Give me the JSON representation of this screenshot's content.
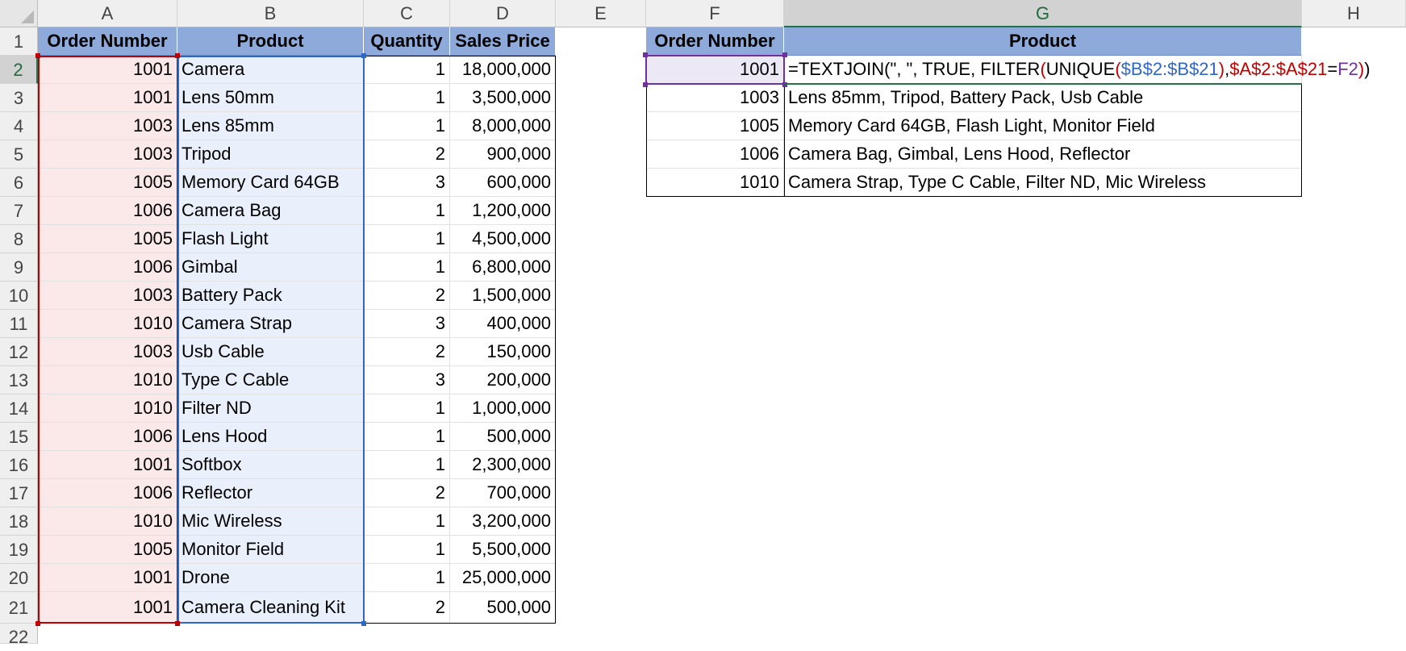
{
  "columns": [
    "A",
    "B",
    "C",
    "D",
    "E",
    "F",
    "G",
    "H"
  ],
  "rows": [
    "1",
    "2",
    "3",
    "4",
    "5",
    "6",
    "7",
    "8",
    "9",
    "10",
    "11",
    "12",
    "13",
    "14",
    "15",
    "16",
    "17",
    "18",
    "19",
    "20",
    "21",
    "22"
  ],
  "table1": {
    "headers": [
      "Order Number",
      "Product",
      "Quantity",
      "Sales Price"
    ],
    "rows": [
      [
        "1001",
        "Camera",
        "1",
        "18,000,000"
      ],
      [
        "1001",
        "Lens 50mm",
        "1",
        "3,500,000"
      ],
      [
        "1003",
        "Lens 85mm",
        "1",
        "8,000,000"
      ],
      [
        "1003",
        "Tripod",
        "2",
        "900,000"
      ],
      [
        "1005",
        "Memory Card 64GB",
        "3",
        "600,000"
      ],
      [
        "1006",
        "Camera Bag",
        "1",
        "1,200,000"
      ],
      [
        "1005",
        "Flash Light",
        "1",
        "4,500,000"
      ],
      [
        "1006",
        "Gimbal",
        "1",
        "6,800,000"
      ],
      [
        "1003",
        "Battery Pack",
        "2",
        "1,500,000"
      ],
      [
        "1010",
        "Camera Strap",
        "3",
        "400,000"
      ],
      [
        "1003",
        "Usb Cable",
        "2",
        "150,000"
      ],
      [
        "1010",
        "Type C Cable",
        "3",
        "200,000"
      ],
      [
        "1010",
        "Filter ND",
        "1",
        "1,000,000"
      ],
      [
        "1006",
        "Lens Hood",
        "1",
        "500,000"
      ],
      [
        "1001",
        "Softbox",
        "1",
        "2,300,000"
      ],
      [
        "1006",
        "Reflector",
        "2",
        "700,000"
      ],
      [
        "1010",
        "Mic Wireless",
        "1",
        "3,200,000"
      ],
      [
        "1005",
        "Monitor Field",
        "1",
        "5,500,000"
      ],
      [
        "1001",
        "Drone",
        "1",
        "25,000,000"
      ],
      [
        "1001",
        "Camera Cleaning Kit",
        "2",
        "500,000"
      ]
    ]
  },
  "table2": {
    "headers": [
      "Order Number",
      "Product"
    ],
    "rows": [
      [
        "1001",
        ""
      ],
      [
        "1003",
        "Lens 85mm, Tripod, Battery Pack, Usb Cable"
      ],
      [
        "1005",
        "Memory Card 64GB, Flash Light, Monitor Field"
      ],
      [
        "1006",
        "Camera Bag, Gimbal, Lens Hood, Reflector"
      ],
      [
        "1010",
        "Camera Strap, Type C Cable, Filter ND, Mic Wireless"
      ]
    ]
  },
  "formula": {
    "p1": "=TEXTJOIN(\", \", TRUE, FILTER",
    "p2": "(",
    "p3": "UNIQUE",
    "p4": "(",
    "p5": "$B$2:$B$21",
    "p6": ")",
    "p7": ", ",
    "p8": "$A$2:$A$21",
    "p9": "=",
    "p10": "F2",
    "p11": ")",
    "p12": ")"
  },
  "colors": {
    "header_fill": "#8eaadb",
    "range_a": "#c00000",
    "range_b": "#2f67c7",
    "ref_f2": "#7030a0",
    "active_green": "#217346"
  }
}
